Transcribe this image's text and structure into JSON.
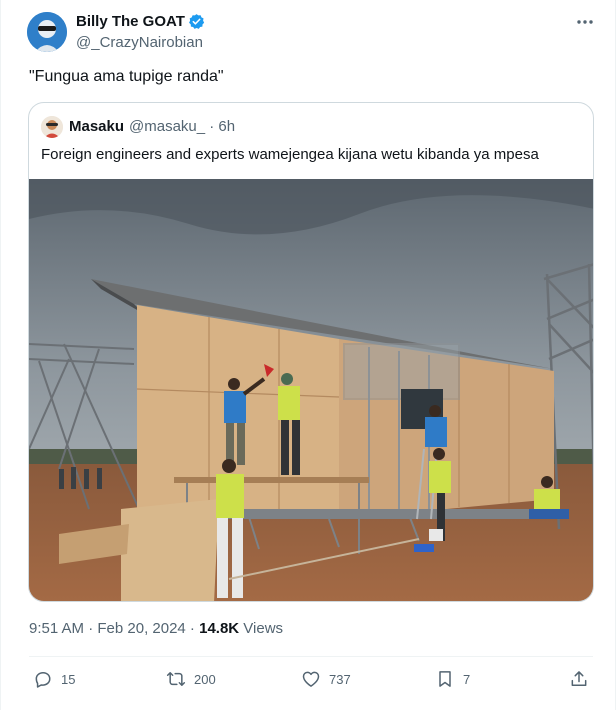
{
  "tweet": {
    "author_name": "Billy The GOAT",
    "author_handle": "@_CrazyNairobian",
    "text": "\"Fungua ama tupige randa\"",
    "timestamp": "9:51 AM · Feb 20, 2024 · ",
    "views_count": "14.8K",
    "views_label": " Views"
  },
  "quoted": {
    "name": "Masaku",
    "handle_time": "@masaku_ · 6h",
    "text": "Foreign engineers and experts wamejengea kijana wetu kibanda ya mpesa"
  },
  "actions": {
    "replies": "15",
    "retweets": "200",
    "likes": "737",
    "bookmarks": "7"
  },
  "icons": [
    "verified-badge-icon",
    "more-icon",
    "reply-icon",
    "retweet-icon",
    "like-icon",
    "bookmark-icon",
    "share-icon"
  ],
  "colors": {
    "verified": "#1d9bf0",
    "text": "#0f1419",
    "muted": "#536471",
    "border": "#cfd9de"
  }
}
